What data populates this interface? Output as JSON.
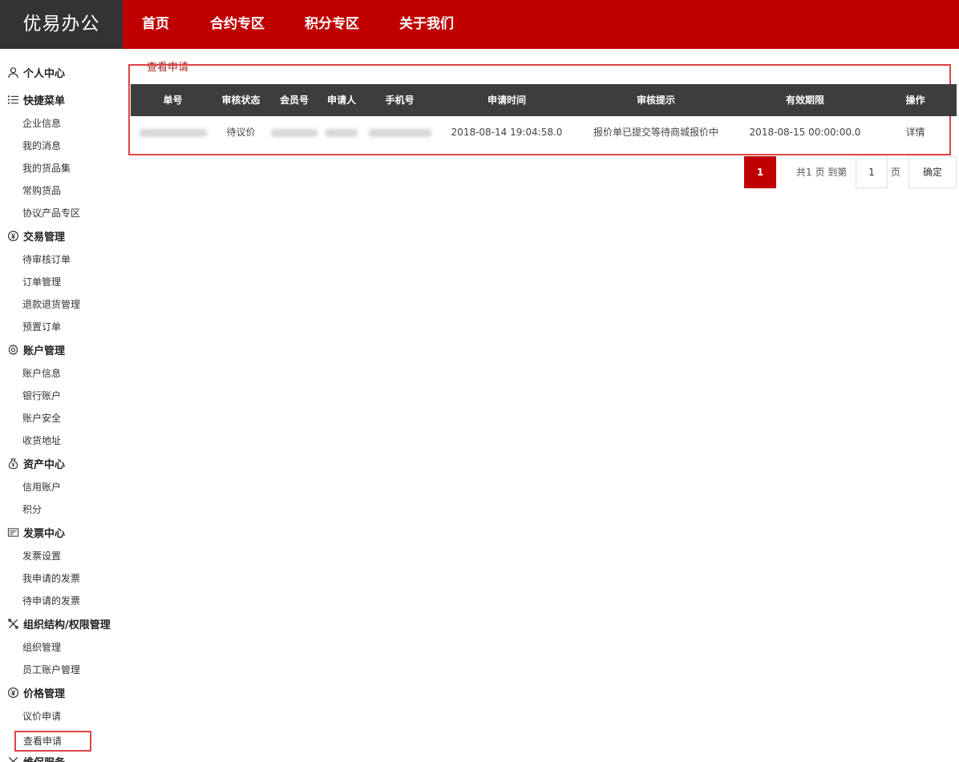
{
  "brand": "优易办公",
  "nav": [
    "首页",
    "合约专区",
    "积分专区",
    "关于我们"
  ],
  "sidebar": {
    "personal": "个人中心",
    "quick": {
      "title": "快捷菜单",
      "items": [
        "企业信息",
        "我的消息",
        "我的货品集",
        "常购货品",
        "协议产品专区"
      ]
    },
    "trade": {
      "title": "交易管理",
      "items": [
        "待审核订单",
        "订单管理",
        "退款退货管理",
        "预置订单"
      ]
    },
    "account": {
      "title": "账户管理",
      "items": [
        "账户信息",
        "银行账户",
        "账户安全",
        "收货地址"
      ]
    },
    "asset": {
      "title": "资产中心",
      "items": [
        "信用账户",
        "积分"
      ]
    },
    "invoice": {
      "title": "发票中心",
      "items": [
        "发票设置",
        "我申请的发票",
        "待申请的发票"
      ]
    },
    "org": {
      "title": "组织结构/权限管理",
      "items": [
        "组织管理",
        "员工账户管理"
      ]
    },
    "price": {
      "title": "价格管理",
      "items": [
        "议价申请",
        "查看申请"
      ]
    },
    "service": {
      "title": "维保服务"
    }
  },
  "breadcrumb": "查看申请",
  "table": {
    "headers": [
      "单号",
      "审核状态",
      "会员号",
      "申请人",
      "手机号",
      "申请时间",
      "审核提示",
      "有效期限",
      "操作"
    ],
    "row": {
      "status": "待议价",
      "apply_time": "2018-08-14 19:04:58.0",
      "tip": "报价单已提交等待商城报价中",
      "expiry": "2018-08-15 00:00:00.0",
      "action": "详情"
    }
  },
  "pager": {
    "current": "1",
    "summary": "共1 页 到第",
    "goto_value": "1",
    "unit": "页",
    "confirm": "确定"
  },
  "colors": {
    "brand_red": "#c00000",
    "dark": "#333333",
    "highlight_border": "#e04343"
  }
}
